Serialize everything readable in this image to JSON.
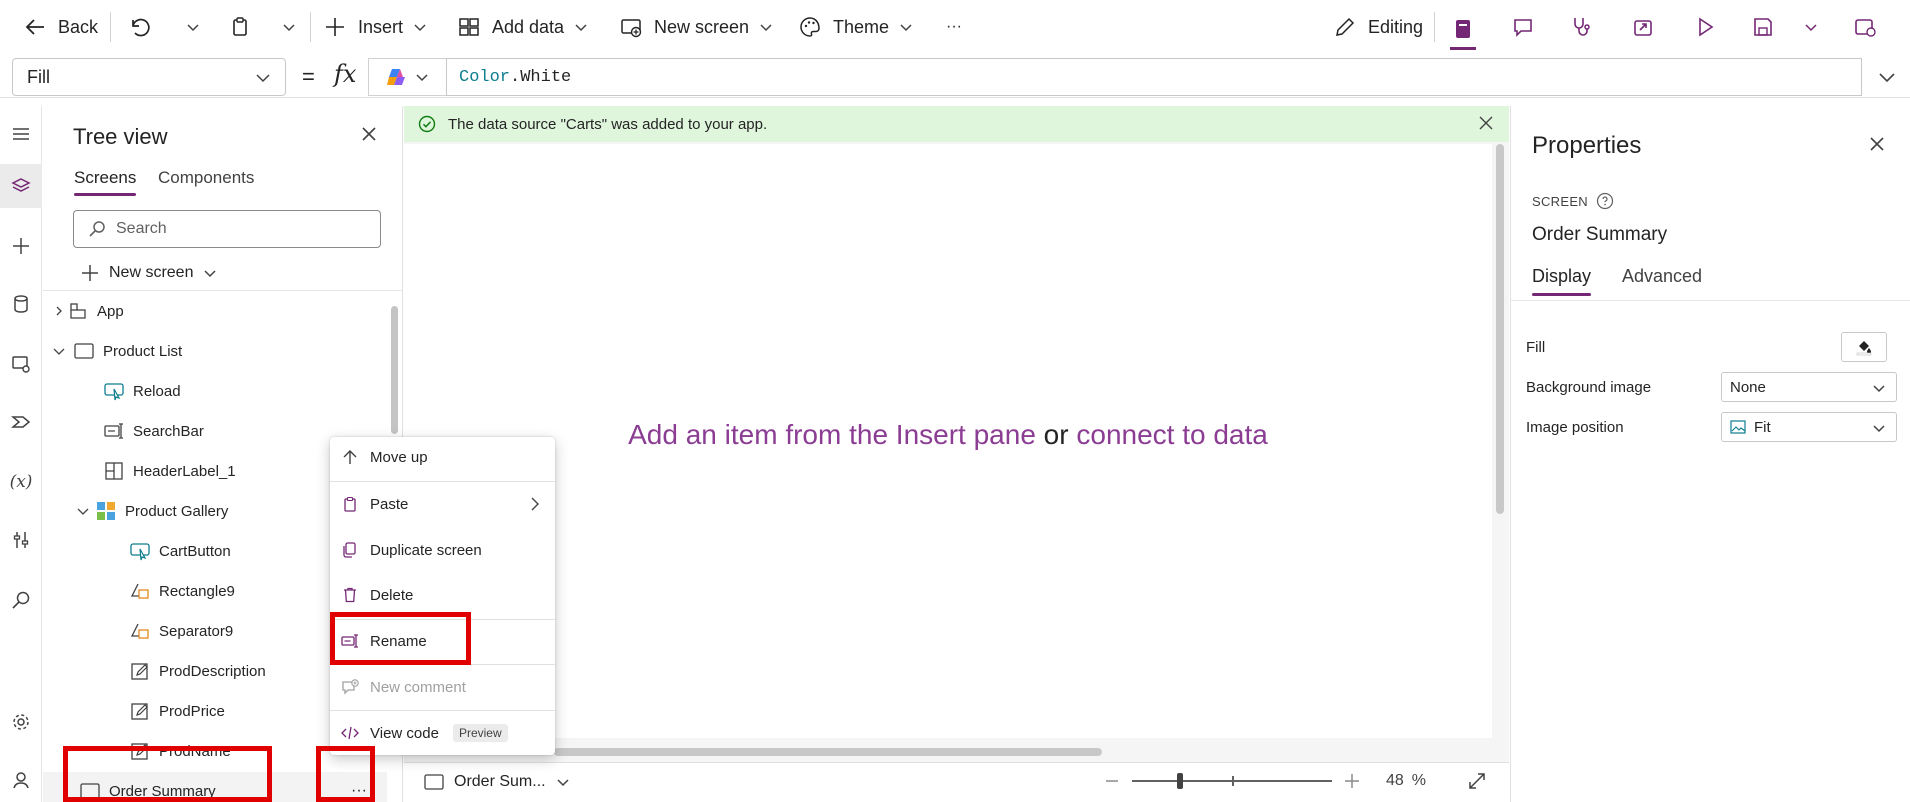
{
  "colors": {
    "accent": "#742774",
    "link": "#8b3c93",
    "notice_bg": "#dff6dd",
    "highlight": "#e00000"
  },
  "toolbar": {
    "back": "Back",
    "insert": "Insert",
    "add_data": "Add data",
    "new_screen": "New screen",
    "theme": "Theme",
    "more": "···",
    "editing": "Editing"
  },
  "formula": {
    "property": "Fill",
    "equals": "=",
    "fx": "fx",
    "expr_type": "Color",
    "expr_member": ".White"
  },
  "tree": {
    "title": "Tree view",
    "tabs": [
      "Screens",
      "Components"
    ],
    "search_placeholder": "Search",
    "new_screen": "New screen",
    "nodes": {
      "app": "App",
      "product_list": "Product List",
      "reload": "Reload",
      "searchbar": "SearchBar",
      "headerlabel": "HeaderLabel_1",
      "product_gallery": "Product Gallery",
      "cartbutton": "CartButton",
      "rectangle9": "Rectangle9",
      "separator9": "Separator9",
      "proddescription": "ProdDescription",
      "prodprice": "ProdPrice",
      "prodname": "ProdName",
      "order_summary": "Order Summary"
    },
    "more_button": "···"
  },
  "notice": "The data source \"Carts\" was added to your app.",
  "canvas": {
    "msg_part1": "Add an item from the Insert pane",
    "msg_or": " or ",
    "msg_part2": "connect to data"
  },
  "statusbar": {
    "screen": "Order Sum...",
    "zoom_value": "48",
    "zoom_unit": "%",
    "zoom_level": 0.48
  },
  "context_menu": {
    "move_up": "Move up",
    "paste": "Paste",
    "duplicate": "Duplicate screen",
    "delete": "Delete",
    "rename": "Rename",
    "new_comment": "New comment",
    "view_code": "View code",
    "preview_badge": "Preview"
  },
  "properties": {
    "title": "Properties",
    "kind": "SCREEN",
    "name": "Order Summary",
    "tabs": [
      "Display",
      "Advanced"
    ],
    "rows": {
      "fill_label": "Fill",
      "bg_label": "Background image",
      "bg_value": "None",
      "pos_label": "Image position",
      "pos_value": "Fit"
    }
  }
}
